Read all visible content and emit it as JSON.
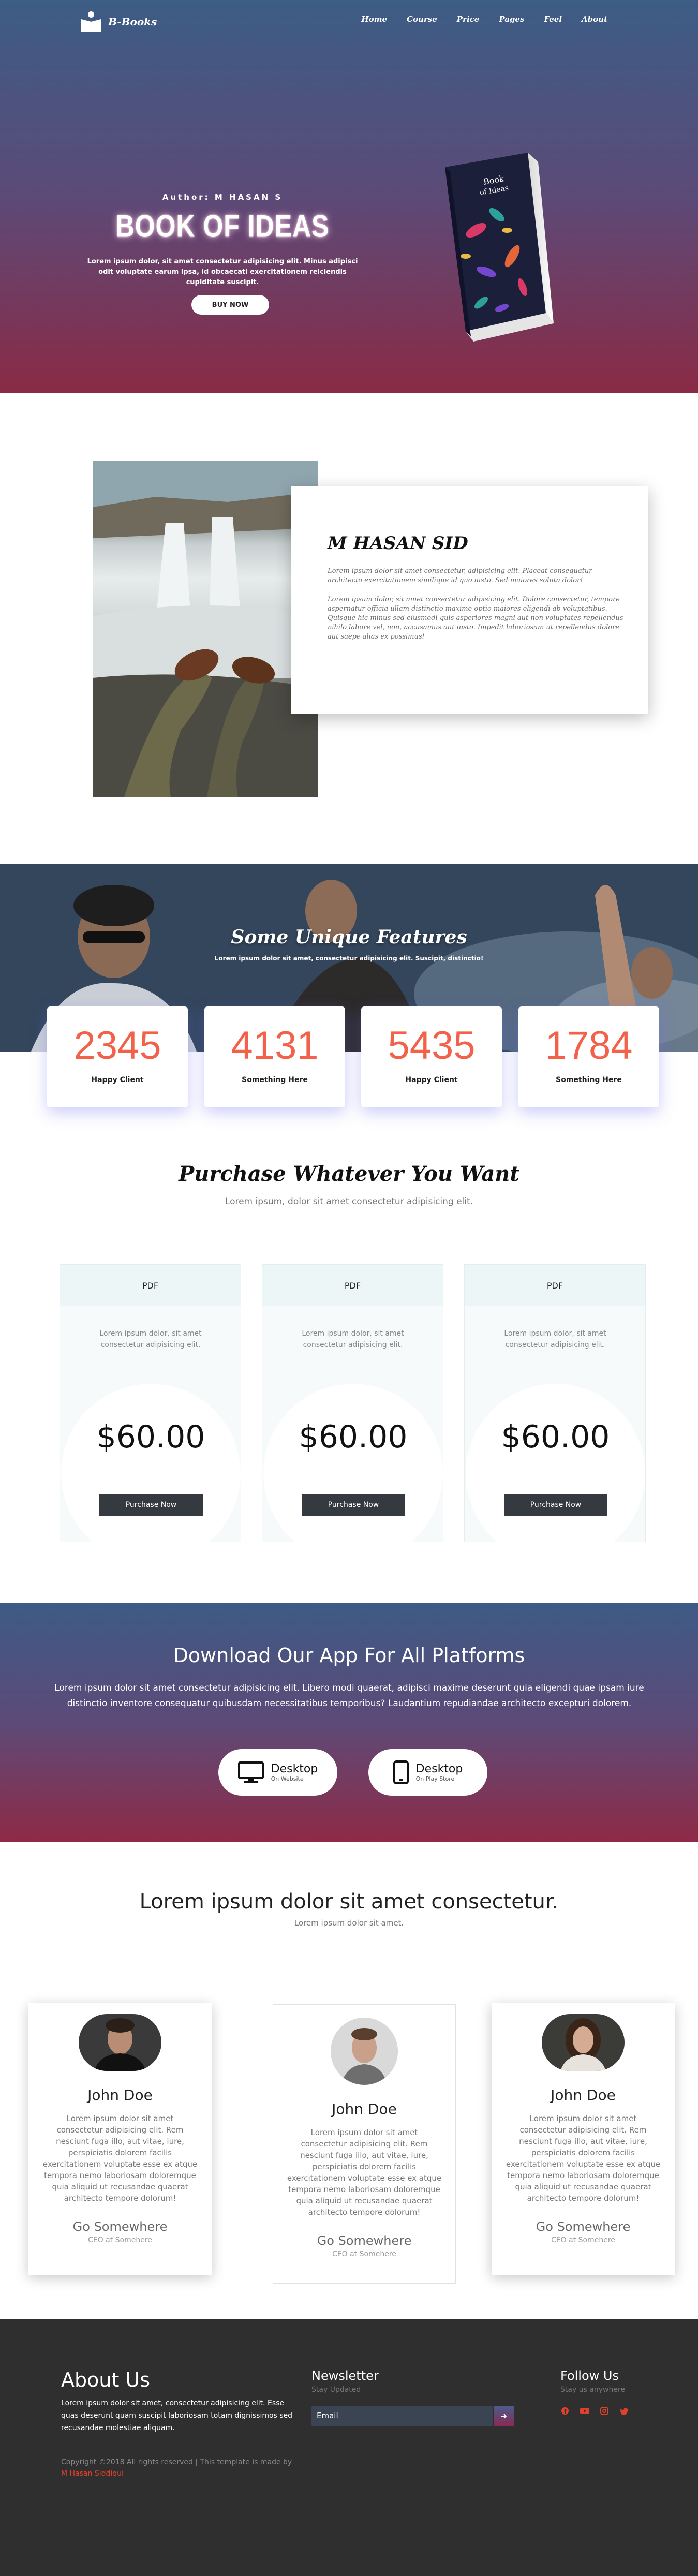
{
  "nav": {
    "logo_text": "B-Books",
    "links": [
      "Home",
      "Course",
      "Price",
      "Pages",
      "Feel",
      "About"
    ]
  },
  "hero": {
    "author": "Author: M HASAN S",
    "title": "BOOK OF IDEAS",
    "subtitle": "Lorem ipsum dolor, sit amet consectetur adipisicing elit. Minus adipisci odit voluptate earum ipsa, id obcaecati exercitationem reiciendis cupiditate suscipit.",
    "button": "BUY NOW",
    "book_cover_text": [
      "Book",
      "of Ideas"
    ]
  },
  "about": {
    "name": "M HASAN SID",
    "paragraph1": "Lorem ipsum dolor sit amet consectetur, adipisicing elit. Placeat consequatur architecto exercitationem similique id quo iusto. Sed maiores soluta dolor!",
    "paragraph2": "Lorem ipsum dolor, sit amet consectetur adipisicing elit. Dolore consectetur, tempore aspernatur officia ullam distinctio maxime optio maiores eligendi ab voluptatibus. Quisque hic minus sed eiusmodi quis asperiores magni aut non voluptates repellendus nihilo labore vel, non, accusamus aut iusto. Impedit laboriosam ut repellendus dolore aut saepe alias ex possimus!"
  },
  "features": {
    "title": "Some Unique Features",
    "subtitle": "Lorem ipsum dolor sit amet, consectetur adipisicing elit. Suscipit, distinctio!",
    "stats": [
      {
        "value": "2345",
        "label": "Happy Client"
      },
      {
        "value": "4131",
        "label": "Something Here"
      },
      {
        "value": "5435",
        "label": "Happy Client"
      },
      {
        "value": "1784",
        "label": "Something Here"
      }
    ]
  },
  "purchase": {
    "title": "Purchase Whatever You Want",
    "subtitle": "Lorem ipsum, dolor sit amet consectetur adipisicing elit.",
    "plans": [
      {
        "format": "PDF",
        "desc": "Lorem ipsum dolor, sit amet consectetur adipisicing elit.",
        "price": "$60.00",
        "button": "Purchase Now"
      },
      {
        "format": "PDF",
        "desc": "Lorem ipsum dolor, sit amet consectetur adipisicing elit.",
        "price": "$60.00",
        "button": "Purchase Now"
      },
      {
        "format": "PDF",
        "desc": "Lorem ipsum dolor, sit amet consectetur adipisicing elit.",
        "price": "$60.00",
        "button": "Purchase Now"
      }
    ]
  },
  "download": {
    "title": "Download Our App For All Platforms",
    "text": "Lorem ipsum dolor sit amet consectetur adipisicing elit. Libero modi quaerat, adipisci maxime deserunt quia eligendi quae ipsam iure distinctio inventore consequatur quibusdam necessitatibus temporibus? Laudantium repudiandae architecto excepturi dolorem.",
    "buttons": [
      {
        "title": "Desktop",
        "sub": "On Website"
      },
      {
        "title": "Desktop",
        "sub": "On Play Store"
      }
    ]
  },
  "team": {
    "title": "Lorem ipsum dolor sit amet consectetur.",
    "subtitle": "Lorem ipsum dolor sit amet.",
    "members": [
      {
        "name": "John Doe",
        "bio": "Lorem ipsum dolor sit amet consectetur adipisicing elit. Rem nesciunt fuga illo, aut vitae, iure, perspiciatis dolorem facilis exercitationem voluptate esse ex atque tempora nemo laboriosam doloremque quia aliquid ut recusandae quaerat architecto tempore dolorum!",
        "link": "Go Somewhere",
        "role": "CEO at Somehere"
      },
      {
        "name": "John Doe",
        "bio": "Lorem ipsum dolor sit amet consectetur adipisicing elit. Rem nesciunt fuga illo, aut vitae, iure, perspiciatis dolorem facilis exercitationem voluptate esse ex atque tempora nemo laboriosam doloremque quia aliquid ut recusandae quaerat architecto tempore dolorum!",
        "link": "Go Somewhere",
        "role": "CEO at Somehere"
      },
      {
        "name": "John Doe",
        "bio": "Lorem ipsum dolor sit amet consectetur adipisicing elit. Rem nesciunt fuga illo, aut vitae, iure, perspiciatis dolorem facilis exercitationem voluptate esse ex atque tempora nemo laboriosam doloremque quia aliquid ut recusandae quaerat architecto tempore dolorum!",
        "link": "Go Somewhere",
        "role": "CEO at Somehere"
      }
    ]
  },
  "footer": {
    "about_title": "About Us",
    "about_text": "Lorem ipsum dolor sit amet, consectetur adipisicing elit. Esse quas deserunt quam suscipit laboriosam totam dignissimos sed recusandae molestiae aliquam.",
    "copyright": "Copyright ©2018 All rights reserved | This template is made by",
    "author": "M Hasan Siddiqui",
    "newsletter_title": "Newsletter",
    "newsletter_sub": "Stay Updated",
    "email_placeholder": "Email",
    "follow_title": "Follow Us",
    "follow_sub": "Stay us anywhere",
    "social_icons": [
      "facebook-icon",
      "youtube-icon",
      "instagram-icon",
      "twitter-icon"
    ]
  },
  "colors": {
    "accent": "#f2624a",
    "hero_top": "#3c5d85",
    "hero_bottom": "#8a2a45",
    "footer_bg": "#2f2f2f"
  }
}
